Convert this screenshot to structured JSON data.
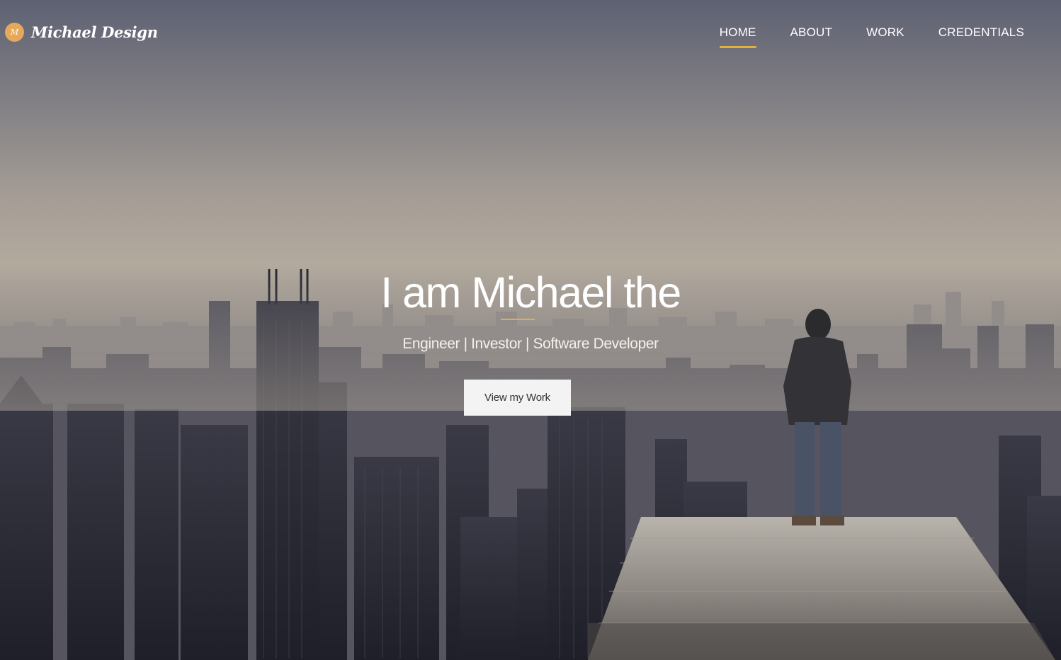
{
  "brand": {
    "mark": "M",
    "name": "Michael Design"
  },
  "nav": {
    "items": [
      {
        "label": "HOME",
        "active": true
      },
      {
        "label": "ABOUT",
        "active": false
      },
      {
        "label": "WORK",
        "active": false
      },
      {
        "label": "CREDENTIALS",
        "active": false
      }
    ]
  },
  "hero": {
    "headline": "I am Michael the",
    "subtitle": "Engineer | Investor | Software Developer",
    "cta_label": "View my Work",
    "background_description_icon": "city-skyline-image"
  },
  "colors": {
    "accent": "#e0b040",
    "brand_mark": "#e6a85a",
    "button_bg": "#f3f3f3",
    "text": "#ffffff"
  }
}
